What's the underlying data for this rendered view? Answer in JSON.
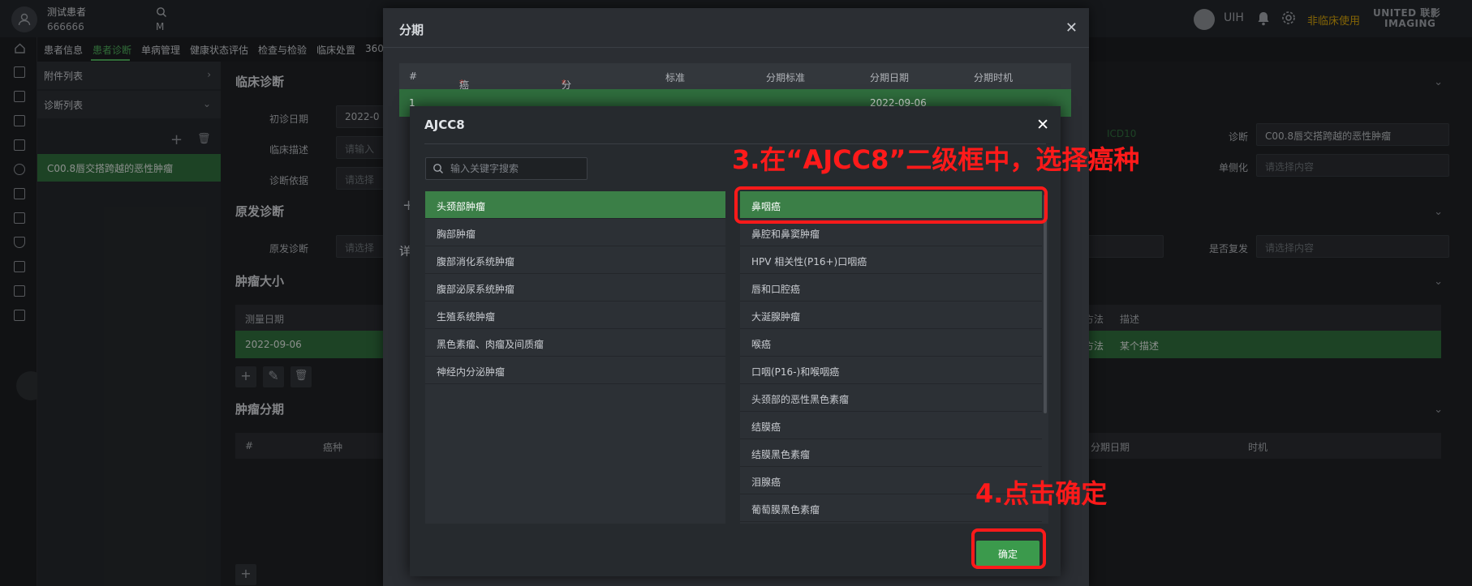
{
  "topbar": {
    "patient_name": "测试患者",
    "patient_id": "666666",
    "patient_sex": "M",
    "user": "UIH",
    "non_clinical": "非临床使用",
    "logo_line1": "UNITED 联影",
    "logo_line2": "IMAGING"
  },
  "nav": {
    "tabs": [
      "患者信息",
      "患者诊断",
      "单病管理",
      "健康状态评估",
      "检查与检验",
      "临床处置",
      "360"
    ]
  },
  "left_panel": {
    "attachments": "附件列表",
    "diagnoses": "诊断列表",
    "item": "C00.8唇交搭跨越的恶性肿瘤"
  },
  "main": {
    "clinical_dx": "临床诊断",
    "first_date_label": "初诊日期",
    "first_date_value": "2022-0",
    "clinical_desc_label": "临床描述",
    "clinical_desc_ph": "请输入",
    "dx_basis_label": "诊断依据",
    "dx_basis_ph": "请选择",
    "icd_label": "ICD10",
    "dx_label": "诊断",
    "dx_value": "C00.8唇交搭跨越的恶性肿瘤",
    "lateral_label": "单侧化",
    "select_ph": "请选择内容",
    "primary_dx": "原发诊断",
    "primary_dx_label": "原发诊断",
    "primary_dx_ph": "请选择",
    "relapse_label": "是否复发",
    "tumor_size": "肿瘤大小",
    "measure_date": "测量日期",
    "method_tail": "方法",
    "desc_col": "描述",
    "size_date": "2022-09-06",
    "size_desc": "某个描述",
    "tumor_stage": "肿瘤分期",
    "stage_cols": [
      "#",
      "癌种",
      "分期日期",
      "时机"
    ]
  },
  "modal_outer": {
    "title": "分期",
    "columns": [
      "#",
      "癌种",
      "分期",
      "标准",
      "分期标准",
      "分期日期",
      "分期时机"
    ],
    "row_index": "1",
    "row_date": "2022-09-06",
    "detail": "详"
  },
  "modal_inner": {
    "title": "AJCC8",
    "search_placeholder": "输入关键字搜索",
    "categories": [
      "头颈部肿瘤",
      "胸部肿瘤",
      "腹部消化系统肿瘤",
      "腹部泌尿系统肿瘤",
      "生殖系统肿瘤",
      "黑色素瘤、肉瘤及间质瘤",
      "神经内分泌肿瘤"
    ],
    "subtypes": [
      "鼻咽癌",
      "鼻腔和鼻窦肿瘤",
      "HPV 相关性(P16+)口咽癌",
      "唇和口腔癌",
      "大涎腺肿瘤",
      "喉癌",
      "口咽(P16-)和喉咽癌",
      "头颈部的恶性黑色素瘤",
      "结膜癌",
      "结膜黑色素瘤",
      "泪腺癌",
      "葡萄膜黑色素瘤"
    ],
    "ok": "确定"
  },
  "annotations": {
    "step3": "3.在“AJCC8”二级框中，选择癌种",
    "step4": "4.点击确定",
    "color": "#ff1a1a"
  }
}
